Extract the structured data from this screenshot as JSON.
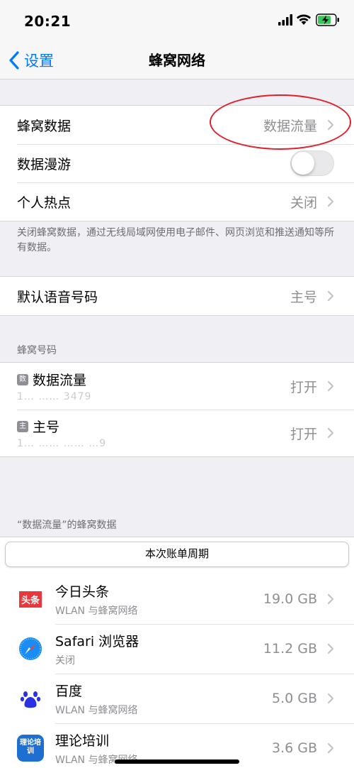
{
  "status": {
    "time": "20:21"
  },
  "nav": {
    "back_label": "设置",
    "title": "蜂窝网络"
  },
  "group1": {
    "cellular_data": {
      "label": "蜂窝数据",
      "value": "数据流量"
    },
    "data_roaming": {
      "label": "数据漫游",
      "on": false
    },
    "hotspot": {
      "label": "个人热点",
      "value": "关闭"
    }
  },
  "footnote1": "关闭蜂窝数据，通过无线局域网使用电子邮件、网页浏览和推送通知等所有数据。",
  "default_voice": {
    "label": "默认语音号码",
    "value": "主号"
  },
  "plans": {
    "header": "蜂窝号码",
    "items": [
      {
        "badge": "数",
        "name": "数据流量",
        "number": "1… …… 3479",
        "value": "打开"
      },
      {
        "badge": "主",
        "name": "主号",
        "number": "1… …… …… …9",
        "value": "打开"
      }
    ]
  },
  "usage": {
    "header": "“数据流量”的蜂窝数据",
    "period_button": "本次账单周期",
    "apps": [
      {
        "name": "今日头条",
        "sub": "WLAN 与蜂窝网络",
        "size": "19.0 GB",
        "icon": "toutiao-icon",
        "icon_text": "头条",
        "color": "#e8383d"
      },
      {
        "name": "Safari 浏览器",
        "sub": "关闭",
        "size": "11.2 GB",
        "icon": "safari-icon",
        "color": "#1a8cf5"
      },
      {
        "name": "百度",
        "sub": "WLAN 与蜂窝网络",
        "size": "5.0 GB",
        "icon": "baidu-icon",
        "icon_text": "du",
        "color": "#2932e1"
      },
      {
        "name": "理论培训",
        "sub": "WLAN 与蜂窝网络",
        "size": "3.6 GB",
        "icon": "theory-training-icon",
        "icon_text": "理论培训",
        "color": "#1f6fd0"
      }
    ]
  }
}
